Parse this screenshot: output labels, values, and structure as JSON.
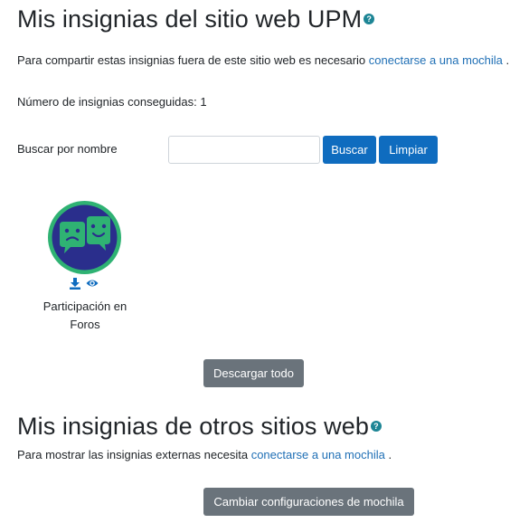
{
  "site_badges": {
    "title": "Mis insignias del sitio web UPM",
    "help_icon": "question-circle-icon",
    "share_text": "Para compartir estas insignias fuera de este sitio web es necesario",
    "share_link": "conectarse a una mochila",
    "share_end": ".",
    "count_text": "Número de insignias conseguidas: 1",
    "search_label": "Buscar por nombre",
    "search_value": "",
    "search_button": "Buscar",
    "clear_button": "Limpiar",
    "badges": [
      {
        "name_line1": "Participación en",
        "name_line2": "Foros",
        "image_icon": "chat-bubbles-badge-icon",
        "download_icon": "download-icon",
        "view_icon": "eye-icon"
      }
    ],
    "download_all_button": "Descargar todo"
  },
  "external_badges": {
    "title": "Mis insignias de otros sitios web",
    "help_icon": "question-circle-icon",
    "text": "Para mostrar las insignias externas necesita",
    "link": "conectarse a una mochila",
    "text_end": ".",
    "backpack_button": "Cambiar configuraciones de mochila"
  },
  "colors": {
    "primary": "#0f6cbf",
    "secondary": "#6a737b",
    "link": "#1f6fb5",
    "help": "#1d8595",
    "badge_ring": "#2fb273",
    "badge_fill": "#2a2e8c"
  }
}
